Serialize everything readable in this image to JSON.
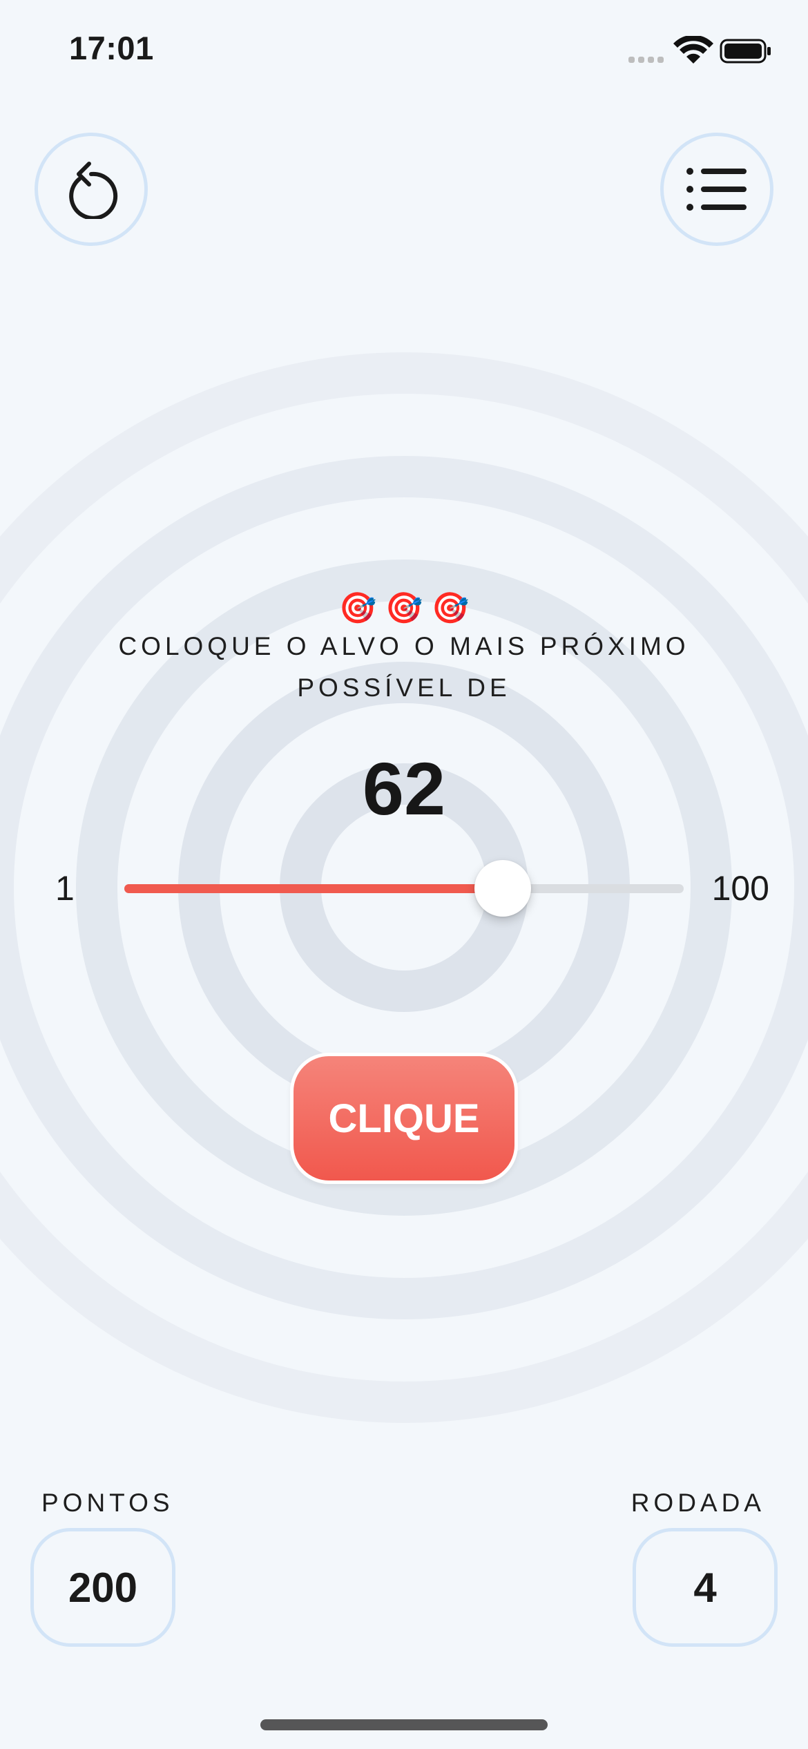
{
  "status_bar": {
    "time": "17:01",
    "signal_icon": "cellular-signal-icon",
    "wifi_icon": "wifi-icon",
    "battery_icon": "battery-icon"
  },
  "toolbar": {
    "restart_icon": "restart-icon",
    "list_icon": "list-icon"
  },
  "game": {
    "emoji": "🎯 🎯 🎯",
    "instruction": "COLOQUE O ALVO O MAIS PRÓXIMO POSSÍVEL DE",
    "target": "62",
    "slider": {
      "min_label": "1",
      "max_label": "100",
      "min": 1,
      "max": 100,
      "value": 68
    },
    "button_label": "CLIQUE"
  },
  "stats": {
    "score_label": "PONTOS",
    "score": "200",
    "round_label": "RODADA",
    "round": "4"
  },
  "colors": {
    "background": "#F3F7FB",
    "accent": "#F05A4F",
    "border": "#D2E4F7",
    "ring": "#DDE4EC"
  }
}
